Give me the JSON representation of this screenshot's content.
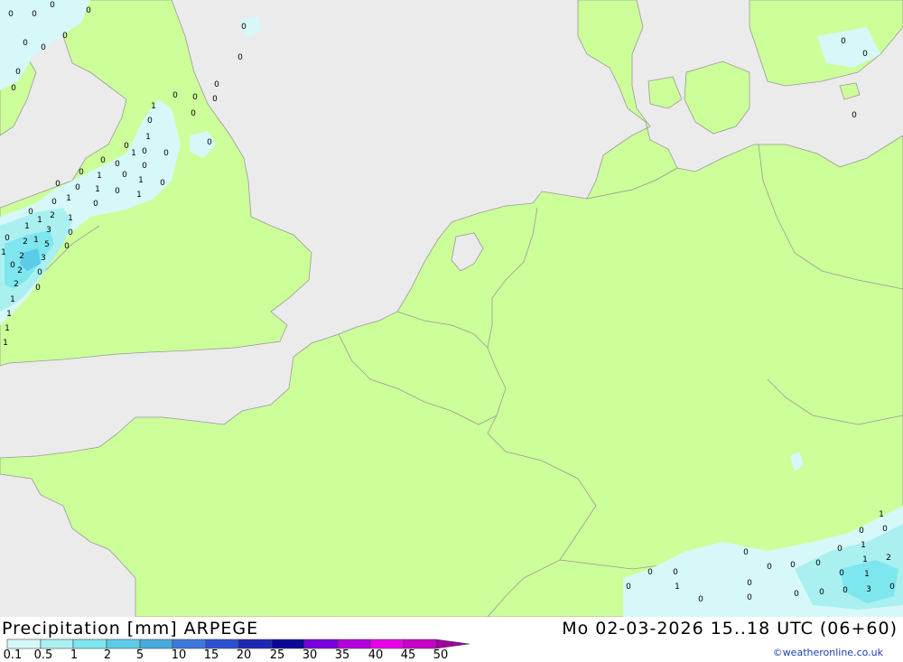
{
  "footer": {
    "title_left": "Precipitation [mm] ARPEGE",
    "title_right": "Mo 02-03-2026 15..18 UTC (06+60)",
    "credit": "©weatheronline.co.uk"
  },
  "legend": {
    "labels": [
      "0.1",
      "0.5",
      "1",
      "2",
      "5",
      "10",
      "15",
      "20",
      "25",
      "30",
      "35",
      "40",
      "45",
      "50"
    ],
    "colors": [
      "#d6f8f8",
      "#aaf0f0",
      "#7ee6ee",
      "#5ccbe8",
      "#46aadc",
      "#3c78dc",
      "#2d50d2",
      "#1e28b4",
      "#0a0a96",
      "#7800dc",
      "#b400dc",
      "#e600e6",
      "#c800c8",
      "#a000a0"
    ]
  },
  "map_colors": {
    "sea": "#ebebeb",
    "land": "#ccff99",
    "border": "#999999"
  },
  "map_values": [
    "0",
    "0",
    "0",
    "0",
    "0",
    "0",
    "0",
    "0",
    "0",
    "0",
    "0",
    "0",
    "0",
    "0",
    "0",
    "0",
    "0",
    "0",
    "0",
    "0",
    "0",
    "0",
    "0",
    "0",
    "1",
    "0",
    "1",
    "0",
    "1",
    "0",
    "0",
    "0",
    "1",
    "1",
    "0",
    "1",
    "1",
    "0",
    "0",
    "0",
    "1",
    "1",
    "1",
    "0",
    "1",
    "0",
    "2",
    "1",
    "1",
    "3",
    "0",
    "2",
    "5",
    "0",
    "2",
    "3",
    "2",
    "0",
    "2",
    "1",
    "1",
    "1",
    "1",
    "0",
    "0",
    "0",
    "0",
    "1",
    "0",
    "0",
    "0",
    "0",
    "0",
    "0",
    "0",
    "0",
    "0",
    "1",
    "0",
    "1",
    "1",
    "2",
    "0",
    "1",
    "0",
    "3",
    "0",
    "0",
    "0",
    "0",
    "0",
    "0"
  ]
}
